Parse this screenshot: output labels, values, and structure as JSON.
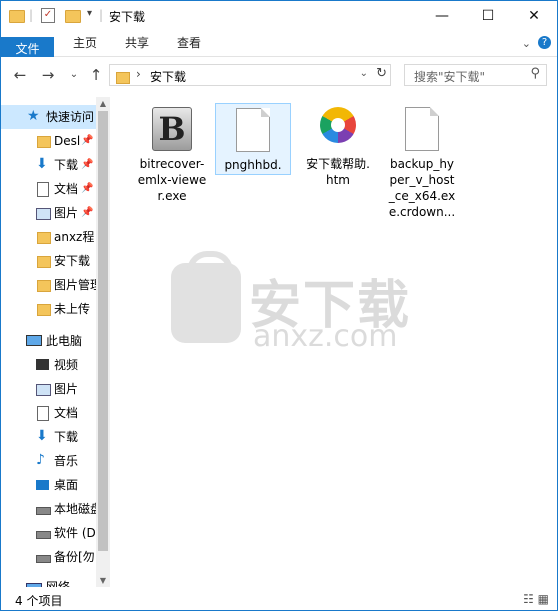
{
  "window": {
    "title": "安下载"
  },
  "ribbon": {
    "tabs": [
      "文件",
      "主页",
      "共享",
      "查看"
    ]
  },
  "nav": {
    "breadcrumb": "安下载",
    "search_placeholder": "搜索\"安下载\""
  },
  "sidebar": {
    "items": [
      {
        "label": "快速访问",
        "icon": "star-icon",
        "pinned": false
      },
      {
        "label": "Desl",
        "icon": "folder-icon",
        "pinned": true
      },
      {
        "label": "下载",
        "icon": "download-arrow-icon",
        "pinned": true
      },
      {
        "label": "文档",
        "icon": "document-icon",
        "pinned": true
      },
      {
        "label": "图片",
        "icon": "picture-icon",
        "pinned": true
      },
      {
        "label": "anxz程",
        "icon": "folder-icon",
        "pinned": false
      },
      {
        "label": "安下载",
        "icon": "folder-icon",
        "pinned": false
      },
      {
        "label": "图片管理",
        "icon": "folder-icon",
        "pinned": false
      },
      {
        "label": "未上传",
        "icon": "folder-icon",
        "pinned": false
      },
      {
        "label": "此电脑",
        "icon": "computer-icon",
        "pinned": false
      },
      {
        "label": "视频",
        "icon": "video-icon",
        "pinned": false
      },
      {
        "label": "图片",
        "icon": "picture-icon",
        "pinned": false
      },
      {
        "label": "文档",
        "icon": "document-icon",
        "pinned": false
      },
      {
        "label": "下载",
        "icon": "download-arrow-icon",
        "pinned": false
      },
      {
        "label": "音乐",
        "icon": "music-icon",
        "pinned": false
      },
      {
        "label": "桌面",
        "icon": "desktop-icon",
        "pinned": false
      },
      {
        "label": "本地磁盘",
        "icon": "drive-icon",
        "pinned": false
      },
      {
        "label": "软件 (D",
        "icon": "drive-icon",
        "pinned": false
      },
      {
        "label": "备份[勿",
        "icon": "drive-icon",
        "pinned": false
      },
      {
        "label": "网络",
        "icon": "network-icon",
        "pinned": false
      }
    ]
  },
  "files": [
    {
      "name": "bitrecover-emlx-viewer.exe",
      "icon": "b-app-icon"
    },
    {
      "name": "pnghhbd.",
      "icon": "blank-file-icon"
    },
    {
      "name": "安下载帮助.htm",
      "icon": "browser-icon"
    },
    {
      "name": "backup_hyper_v_host_ce_x64.exe.crdown...",
      "icon": "blank-file-icon"
    }
  ],
  "watermark": {
    "big": "安下载",
    "small": "anxz.com"
  },
  "status": {
    "count": "4 个项目"
  }
}
